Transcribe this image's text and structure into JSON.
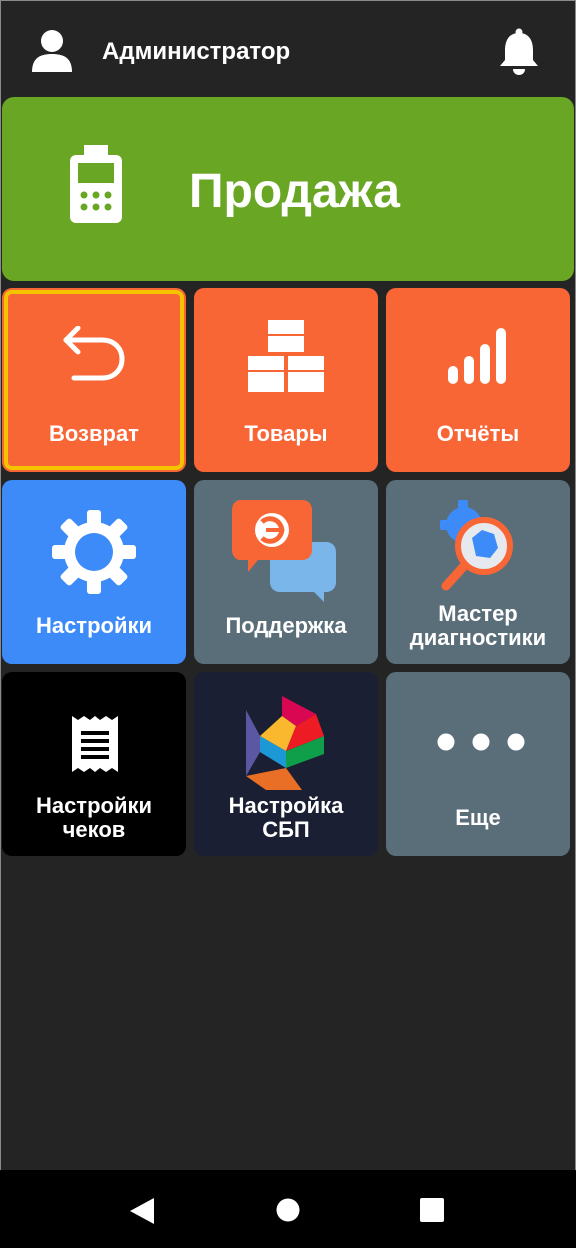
{
  "header": {
    "user_name": "Администратор",
    "user_icon": "user-icon",
    "bell_icon": "bell-icon"
  },
  "sale": {
    "label": "Продажа",
    "icon": "payment-terminal-icon",
    "color": "#68a624"
  },
  "tiles": [
    {
      "label": "Возврат",
      "icon": "return-arrow-icon",
      "color": "#f96636",
      "selected": true
    },
    {
      "label": "Товары",
      "icon": "boxes-icon",
      "color": "#f96636"
    },
    {
      "label": "Отчёты",
      "icon": "bar-chart-icon",
      "color": "#f96636"
    },
    {
      "label": "Настройки",
      "icon": "gear-icon",
      "color": "#3d8bf8"
    },
    {
      "label": "Поддержка",
      "icon": "support-chat-icon",
      "color": "#5a6e7a"
    },
    {
      "label_lines": [
        "Мастер",
        "диагностики"
      ],
      "icon": "diagnostics-gear-magnifier-icon",
      "color": "#5a6e7a"
    },
    {
      "label_lines": [
        "Настройки",
        "чеков"
      ],
      "icon": "receipt-icon",
      "color": "#000000"
    },
    {
      "label_lines": [
        "Настройка",
        "СБП"
      ],
      "icon": "sbp-logo-icon",
      "color": "#1a1f33"
    },
    {
      "label": "Еще",
      "icon": "more-dots-icon",
      "color": "#5a6e7a"
    }
  ],
  "navbar": {
    "back_icon": "back-triangle-icon",
    "home_icon": "home-circle-icon",
    "recents_icon": "recents-square-icon"
  },
  "colors": {
    "background": "#242424",
    "selection_outline": "#f5c400"
  }
}
